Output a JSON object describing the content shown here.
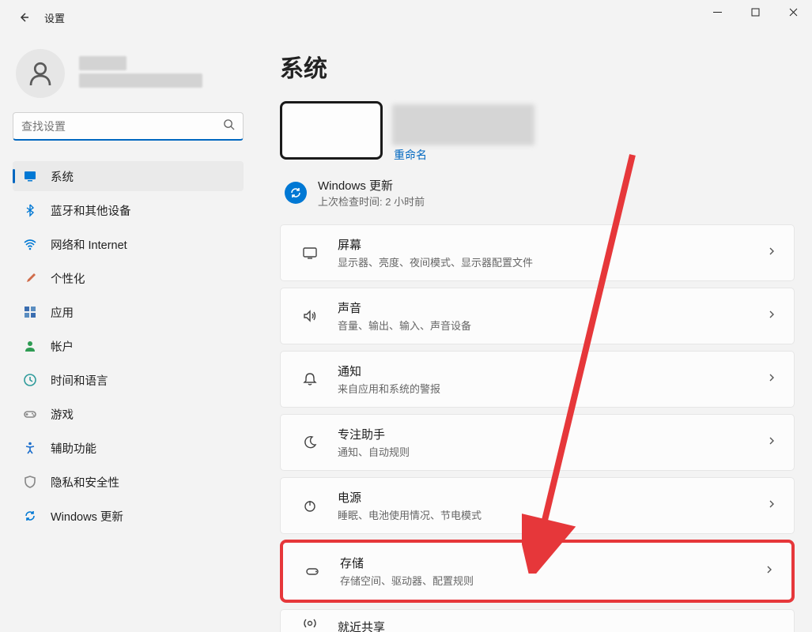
{
  "window": {
    "title": "设置"
  },
  "search": {
    "placeholder": "查找设置"
  },
  "nav": [
    {
      "icon": "monitor",
      "label": "系统",
      "color": "#0078d4",
      "active": true
    },
    {
      "icon": "bluetooth",
      "label": "蓝牙和其他设备",
      "color": "#0078d4"
    },
    {
      "icon": "wifi",
      "label": "网络和 Internet",
      "color": "#0078d4"
    },
    {
      "icon": "brush",
      "label": "个性化",
      "color": "#d06c4a"
    },
    {
      "icon": "apps",
      "label": "应用",
      "color": "#4a6fb0"
    },
    {
      "icon": "person",
      "label": "帐户",
      "color": "#2e9b53"
    },
    {
      "icon": "clock",
      "label": "时间和语言",
      "color": "#2e9b9b"
    },
    {
      "icon": "gamepad",
      "label": "游戏",
      "color": "#888"
    },
    {
      "icon": "access",
      "label": "辅助功能",
      "color": "#1a6dcc"
    },
    {
      "icon": "shield",
      "label": "隐私和安全性",
      "color": "#888"
    },
    {
      "icon": "sync",
      "label": "Windows 更新",
      "color": "#0078d4"
    }
  ],
  "page": {
    "title": "系统",
    "deviceLink": "重命名"
  },
  "update": {
    "title": "Windows 更新",
    "sub": "上次检查时间: 2 小时前"
  },
  "cards": [
    {
      "icon": "display",
      "title": "屏幕",
      "sub": "显示器、亮度、夜间模式、显示器配置文件"
    },
    {
      "icon": "sound",
      "title": "声音",
      "sub": "音量、输出、输入、声音设备"
    },
    {
      "icon": "bell",
      "title": "通知",
      "sub": "来自应用和系统的警报"
    },
    {
      "icon": "moon",
      "title": "专注助手",
      "sub": "通知、自动规则"
    },
    {
      "icon": "power",
      "title": "电源",
      "sub": "睡眠、电池使用情况、节电模式"
    },
    {
      "icon": "storage",
      "title": "存储",
      "sub": "存储空间、驱动器、配置规则",
      "highlight": true
    },
    {
      "icon": "nearby",
      "title": "就近共享",
      "sub": "",
      "partial": true
    }
  ]
}
